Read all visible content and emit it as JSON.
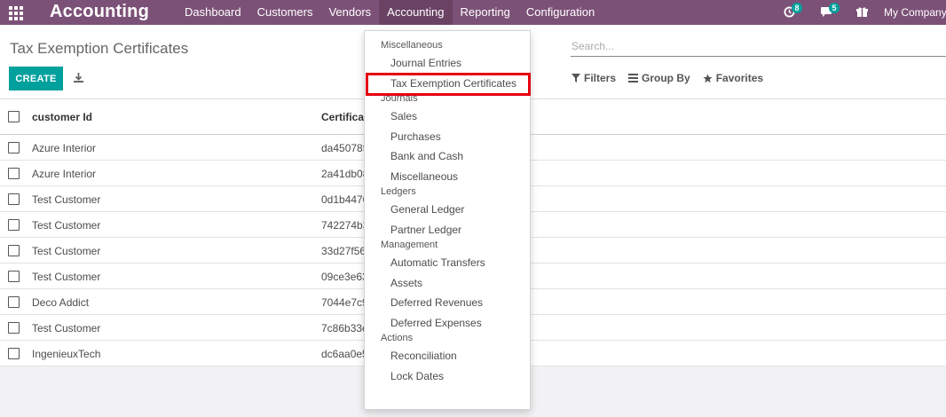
{
  "colors": {
    "navbar": "#7c5177",
    "navbar_active": "#6a4264",
    "primary_button": "#00a09d",
    "badge": "#00a09d",
    "highlight": "#e4000f"
  },
  "navbar": {
    "brand": "Accounting",
    "menu": [
      "Dashboard",
      "Customers",
      "Vendors",
      "Accounting",
      "Reporting",
      "Configuration"
    ],
    "active_menu": "Accounting",
    "activity_badge": "8",
    "messages_badge": "5",
    "company": "My Company"
  },
  "control_panel": {
    "title": "Tax Exemption Certificates",
    "create_label": "CREATE",
    "search_placeholder": "Search...",
    "filters_label": "Filters",
    "group_by_label": "Group By",
    "favorites_label": "Favorites"
  },
  "table": {
    "columns": [
      "customer Id",
      "Certificat"
    ],
    "rows": [
      {
        "customer": "Azure Interior",
        "certificate": "da45078f"
      },
      {
        "customer": "Azure Interior",
        "certificate": "2a41db08"
      },
      {
        "customer": "Test Customer",
        "certificate": "0d1b4470"
      },
      {
        "customer": "Test Customer",
        "certificate": "742274b3"
      },
      {
        "customer": "Test Customer",
        "certificate": "33d27f56"
      },
      {
        "customer": "Test Customer",
        "certificate": "09ce3e63"
      },
      {
        "customer": "Deco Addict",
        "certificate": "7044e7c9"
      },
      {
        "customer": "Test Customer",
        "certificate": "7c86b33e"
      },
      {
        "customer": "IngenieuxTech",
        "certificate": "dc6aa0e5"
      }
    ]
  },
  "dropdown": {
    "sections": [
      {
        "header": "Miscellaneous",
        "items": [
          "Journal Entries",
          "Tax Exemption Certificates"
        ]
      },
      {
        "header": "Journals",
        "items": [
          "Sales",
          "Purchases",
          "Bank and Cash",
          "Miscellaneous"
        ]
      },
      {
        "header": "Ledgers",
        "items": [
          "General Ledger",
          "Partner Ledger"
        ]
      },
      {
        "header": "Management",
        "items": [
          "Automatic Transfers",
          "Assets",
          "Deferred Revenues",
          "Deferred Expenses"
        ]
      },
      {
        "header": "Actions",
        "items": [
          "Reconciliation",
          "Lock Dates"
        ]
      }
    ],
    "highlighted_item": "Tax Exemption Certificates"
  },
  "icons": {
    "apps": "apps-grid-icon",
    "activity": "clock-icon",
    "messages": "chat-icon",
    "gift": "gift-icon",
    "download": "download-icon",
    "filter": "filter-icon",
    "group_by": "bars-icon",
    "favorites": "star-icon"
  }
}
